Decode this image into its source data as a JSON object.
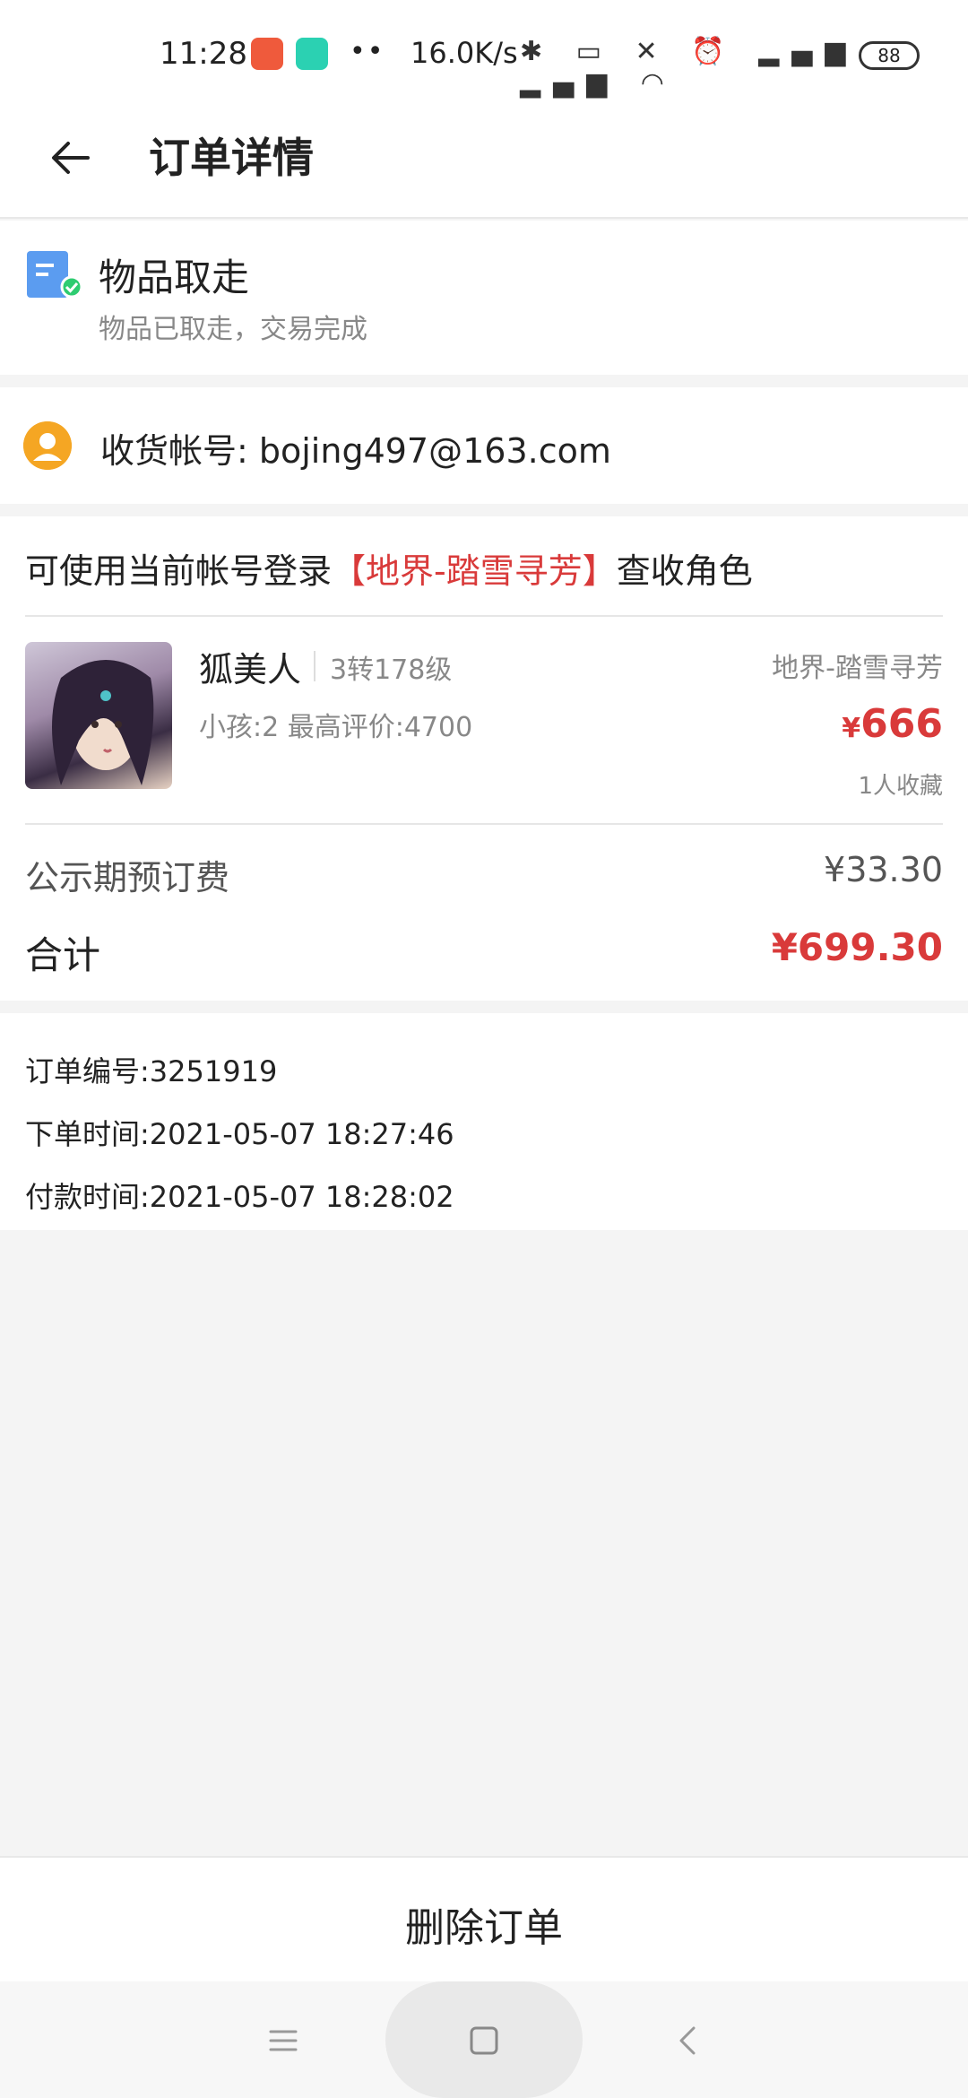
{
  "status_bar": {
    "time": "11:28",
    "dots": "••",
    "net_speed": "16.0K/s",
    "battery": "88",
    "icons": [
      "netease-music-icon",
      "shield-app-icon",
      "bluetooth-icon",
      "toggle-icon",
      "mute-icon",
      "alarm-icon",
      "signal-hd-icon",
      "signal-hd-icon",
      "wifi-icon"
    ]
  },
  "header": {
    "title": "订单详情"
  },
  "order_status": {
    "title": "物品取走",
    "subtitle": "物品已取走，交易完成"
  },
  "account": {
    "label": "收货帐号: bojing497@163.com"
  },
  "login_hint": {
    "prefix": "可使用当前帐号登录",
    "server": "【地界-踏雪寻芳】",
    "suffix": "查收角色"
  },
  "item": {
    "name": "狐美人",
    "level": "3转178级",
    "meta": "小孩:2  最高评价:4700",
    "server": "地界-踏雪寻芳",
    "currency": "¥",
    "price": "666",
    "favorites": "1人收藏"
  },
  "fees": {
    "preorder_label": "公示期预订费",
    "preorder_value": "¥33.30",
    "total_label": "合计",
    "total_value": "¥699.30"
  },
  "order_info": {
    "number": "订单编号:3251919",
    "created": "下单时间:2021-05-07 18:27:46",
    "paid": "付款时间:2021-05-07 18:28:02"
  },
  "actions": {
    "delete": "删除订单"
  },
  "colors": {
    "accent_red": "#d93a3a",
    "muted": "#888888",
    "bg": "#f4f4f4"
  }
}
